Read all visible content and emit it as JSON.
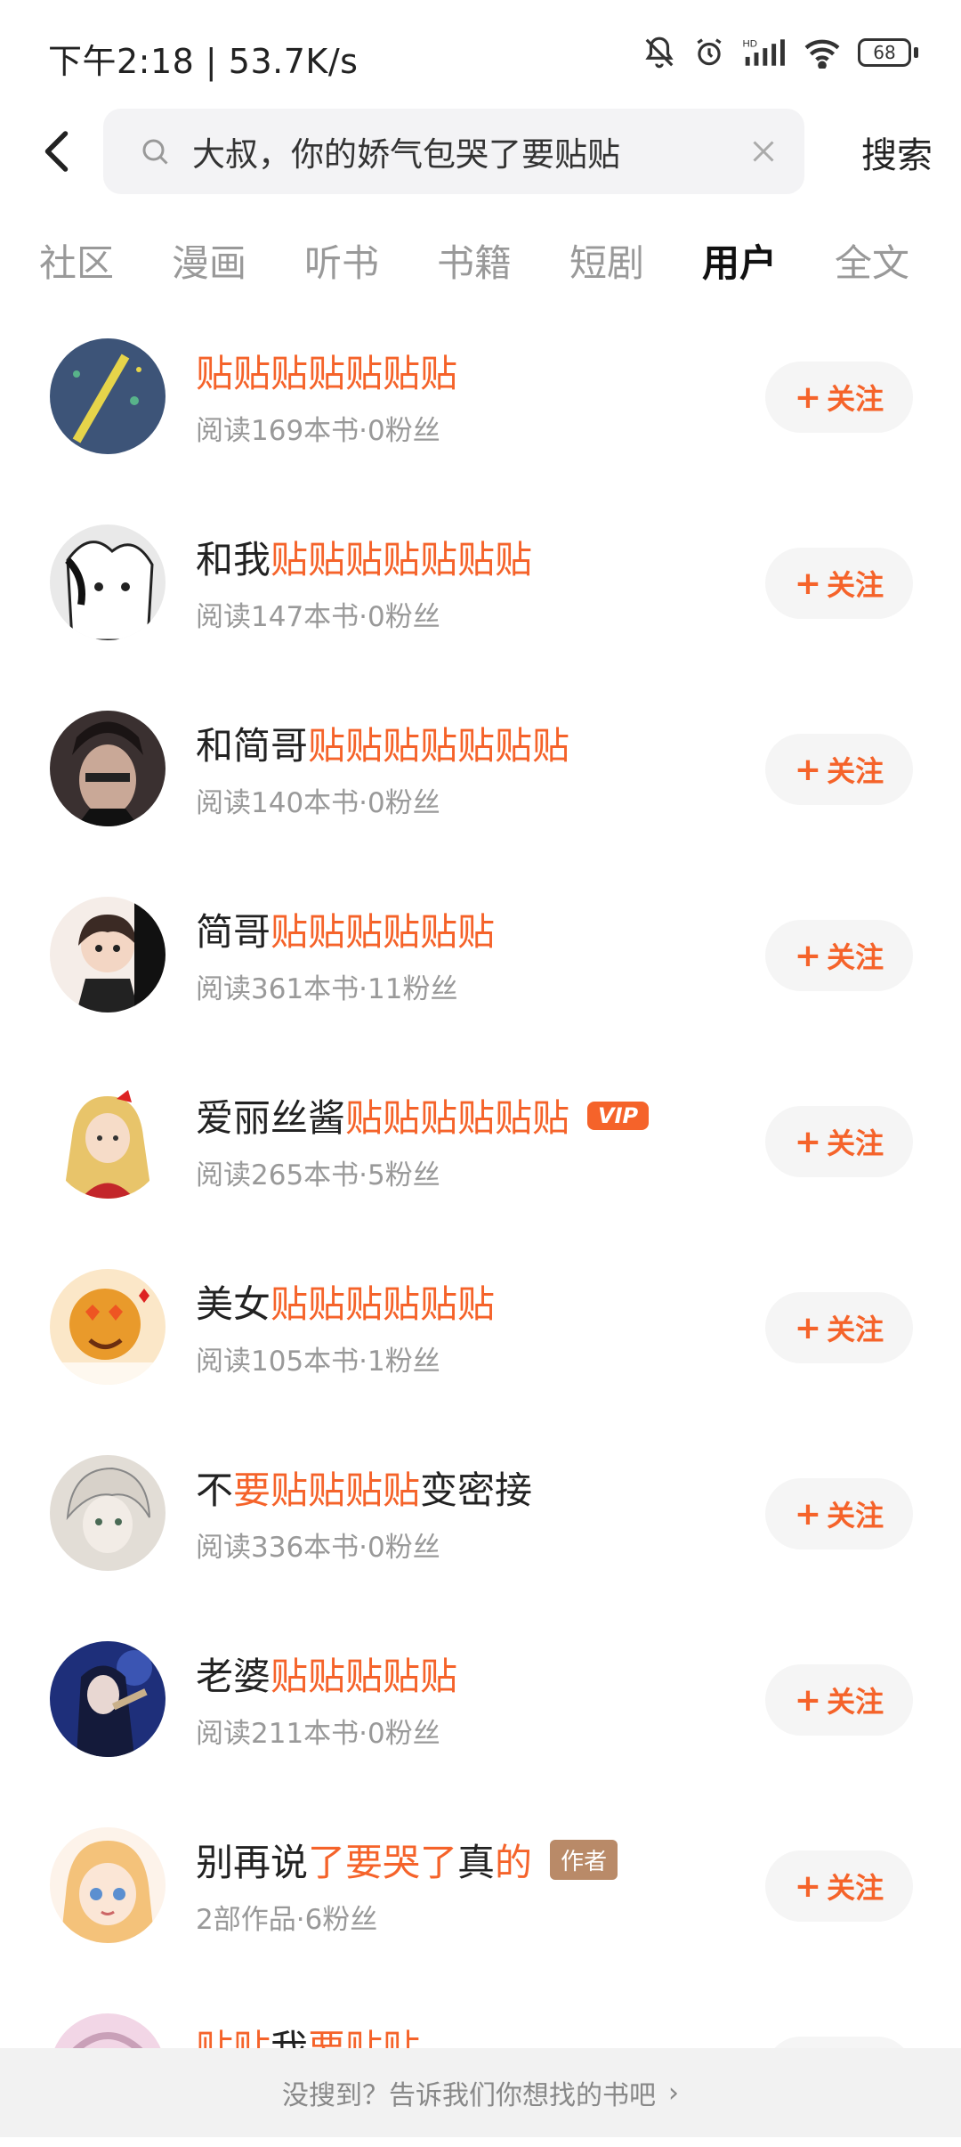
{
  "status": {
    "time": "下午2:18 | 53.7K/s",
    "battery": "68"
  },
  "search": {
    "query": "大叔，你的娇气包哭了要贴贴",
    "button": "搜索"
  },
  "tabs": [
    {
      "label": "社区"
    },
    {
      "label": "漫画"
    },
    {
      "label": "听书"
    },
    {
      "label": "书籍"
    },
    {
      "label": "短剧"
    },
    {
      "label": "用户"
    },
    {
      "label": "全文"
    }
  ],
  "active_tab": "用户",
  "users": [
    {
      "name_prefix": "",
      "name_hl": "贴贴贴贴贴贴贴",
      "name_suffix": "",
      "meta": "阅读169本书·0粉丝",
      "badge": "",
      "follow": "关注"
    },
    {
      "name_prefix": "和我",
      "name_hl": "贴贴贴贴贴贴贴",
      "name_suffix": "",
      "meta": "阅读147本书·0粉丝",
      "badge": "",
      "follow": "关注"
    },
    {
      "name_prefix": "和简哥",
      "name_hl": "贴贴贴贴贴贴贴",
      "name_suffix": "",
      "meta": "阅读140本书·0粉丝",
      "badge": "",
      "follow": "关注"
    },
    {
      "name_prefix": "简哥",
      "name_hl": "贴贴贴贴贴贴",
      "name_suffix": "",
      "meta": "阅读361本书·11粉丝",
      "badge": "",
      "follow": "关注"
    },
    {
      "name_prefix": "爱丽丝酱",
      "name_hl": "贴贴贴贴贴贴",
      "name_suffix": "",
      "meta": "阅读265本书·5粉丝",
      "badge": "VIP",
      "follow": "关注"
    },
    {
      "name_prefix": "美女",
      "name_hl": "贴贴贴贴贴贴",
      "name_suffix": "",
      "meta": "阅读105本书·1粉丝",
      "badge": "",
      "follow": "关注"
    },
    {
      "name_prefix": "不",
      "name_hl": "要贴贴贴贴",
      "name_suffix": "变密接",
      "meta": "阅读336本书·0粉丝",
      "badge": "",
      "follow": "关注"
    },
    {
      "name_prefix": "老婆",
      "name_hl": "贴贴贴贴贴",
      "name_suffix": "",
      "meta": "阅读211本书·0粉丝",
      "badge": "",
      "follow": "关注"
    },
    {
      "name_prefix": "别再说",
      "name_hl": "了要哭了",
      "name_mid": "真",
      "name_hl2": "的",
      "meta": "2部作品·6粉丝",
      "badge": "作者",
      "follow": "关注"
    },
    {
      "name_prefix": "",
      "name_hl": "贴贴",
      "name_mid": "我",
      "name_hl2": "要贴贴",
      "meta": "",
      "badge": "",
      "follow": ""
    }
  ],
  "bottom_hint": "没搜到？告诉我们你想找的书吧",
  "colors": {
    "accent": "#f5632a",
    "author_badge": "#b98a68"
  }
}
